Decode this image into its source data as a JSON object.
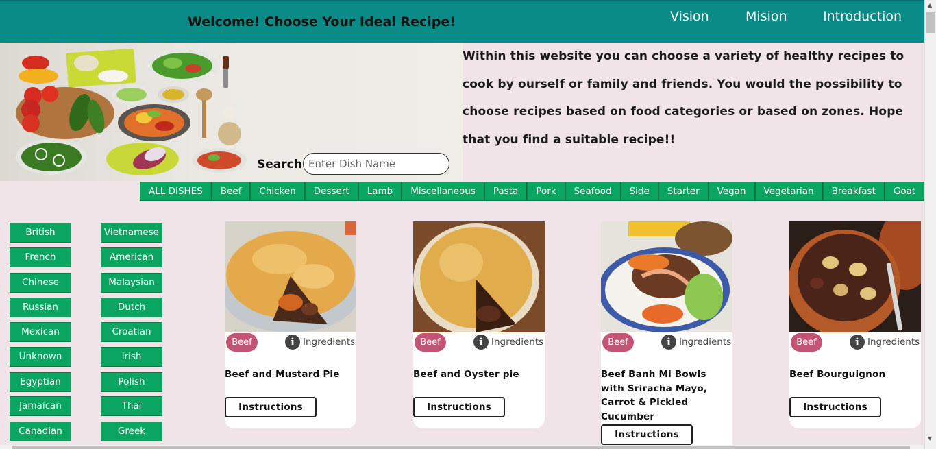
{
  "header": {
    "welcome": "Welcome! Choose Your Ideal Recipe!",
    "nav": [
      "Vision",
      "Mision",
      "Introduction"
    ]
  },
  "search": {
    "label": "Search",
    "placeholder": "Enter Dish Name"
  },
  "intro": "Within this website you can choose a variety of healthy recipes to cook by ourself or family and friends. You would the possibility to choose recipes based on food categories or based on zones. Hope that you find a suitable recipe!!",
  "categories": [
    "ALL DISHES",
    "Beef",
    "Chicken",
    "Dessert",
    "Lamb",
    "Miscellaneous",
    "Pasta",
    "Pork",
    "Seafood",
    "Side",
    "Starter",
    "Vegan",
    "Vegetarian",
    "Breakfast",
    "Goat"
  ],
  "zones_left": [
    "British",
    "French",
    "Chinese",
    "Russian",
    "Mexican",
    "Unknown",
    "Egyptian",
    "Jamaican",
    "Canadian"
  ],
  "zones_right": [
    "Vietnamese",
    "American",
    "Malaysian",
    "Dutch",
    "Croatian",
    "Irish",
    "Polish",
    "Thai",
    "Greek"
  ],
  "recipes": [
    {
      "category": "Beef",
      "ingredients_label": "Ingredients",
      "title": "Beef and Mustard Pie",
      "button": "Instructions"
    },
    {
      "category": "Beef",
      "ingredients_label": "Ingredients",
      "title": "Beef and Oyster pie",
      "button": "Instructions"
    },
    {
      "category": "Beef",
      "ingredients_label": "Ingredients",
      "title": "Beef Banh Mi Bowls with Sriracha Mayo, Carrot & Pickled Cucumber",
      "button": "Instructions"
    },
    {
      "category": "Beef",
      "ingredients_label": "Ingredients",
      "title": "Beef Bourguignon",
      "button": "Instructions"
    }
  ],
  "colors": {
    "header": "#0a8b88",
    "background": "#f0e4e8",
    "category_button": "#0aa560",
    "badge": "#c25573"
  }
}
